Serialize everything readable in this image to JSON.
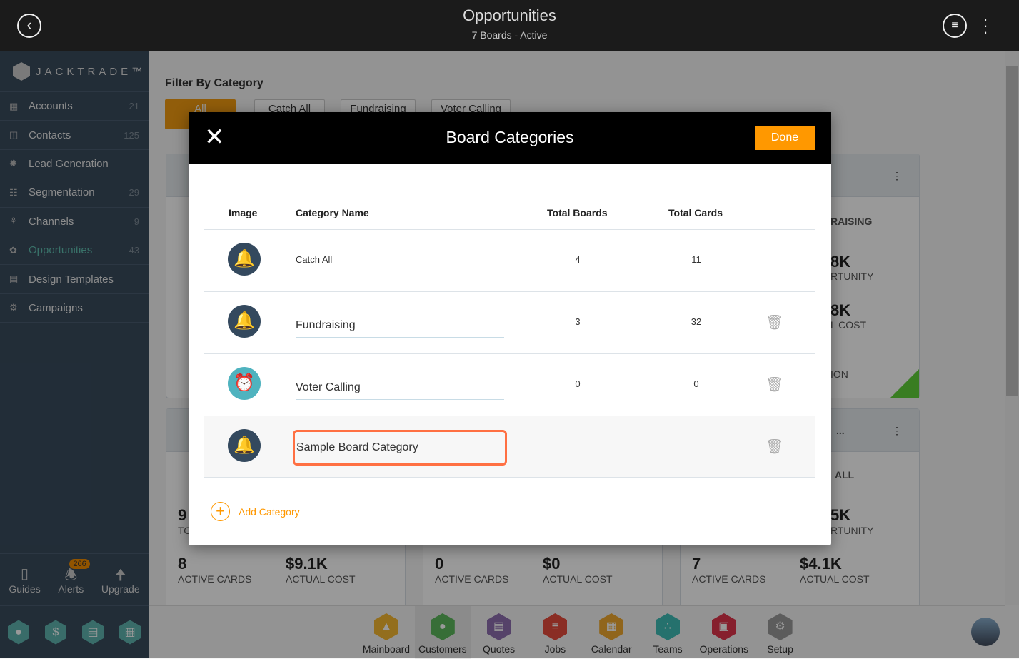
{
  "header": {
    "title": "Opportunities",
    "subtitle": "7 Boards - Active"
  },
  "sidebar": {
    "brand": "JACKTRADE™",
    "items": [
      {
        "label": "Accounts",
        "count": "21",
        "icon": "building-icon"
      },
      {
        "label": "Contacts",
        "count": "125",
        "icon": "contacts-icon"
      },
      {
        "label": "Lead Generation",
        "count": "",
        "icon": "lead-icon"
      },
      {
        "label": "Segmentation",
        "count": "29",
        "icon": "segmentation-icon"
      },
      {
        "label": "Channels",
        "count": "9",
        "icon": "channels-icon"
      },
      {
        "label": "Opportunities",
        "count": "43",
        "icon": "opportunities-icon",
        "active": true
      },
      {
        "label": "Design Templates",
        "count": "",
        "icon": "templates-icon"
      },
      {
        "label": "Campaigns",
        "count": "",
        "icon": "campaigns-icon"
      }
    ],
    "bottom": {
      "guides": "Guides",
      "alerts": "Alerts",
      "alerts_badge": "266",
      "upgrade": "Upgrade"
    }
  },
  "main": {
    "filter_title": "Filter By Category",
    "filters": [
      "All",
      "Catch All",
      "Fundraising",
      "Voter Calling"
    ],
    "cards": {
      "r1c3": {
        "title": "RAISING",
        "v1": "8K",
        "l1": "RTUNITY",
        "v2": "8K",
        "l2": "L COST",
        "l3": "ION"
      },
      "r2c1": {
        "v0": "9",
        "l0": "TO",
        "v1": "8",
        "l1": "ACTIVE CARDS",
        "v2": "$9.1K",
        "l2": "ACTUAL COST"
      },
      "r2c2": {
        "v1": "0",
        "l1": "ACTIVE CARDS",
        "v2": "$0",
        "l2": "ACTUAL COST"
      },
      "r2c3": {
        "head": "...",
        "title": "ALL",
        "v0": "5K",
        "l0": "RTUNITY",
        "v1": "7",
        "l1": "ACTIVE CARDS",
        "v2": "$4.1K",
        "l2": "ACTUAL COST"
      }
    }
  },
  "bottom_nav": [
    {
      "label": "Mainboard",
      "color": "#f5b731"
    },
    {
      "label": "Customers",
      "color": "#5cb85c"
    },
    {
      "label": "Quotes",
      "color": "#8e6fb0"
    },
    {
      "label": "Jobs",
      "color": "#e74c3c"
    },
    {
      "label": "Calendar",
      "color": "#f0a830"
    },
    {
      "label": "Teams",
      "color": "#3ebdb6"
    },
    {
      "label": "Operations",
      "color": "#e0344c"
    },
    {
      "label": "Setup",
      "color": "#999999"
    }
  ],
  "modal": {
    "title": "Board Categories",
    "done": "Done",
    "columns": {
      "image": "Image",
      "name": "Category Name",
      "boards": "Total Boards",
      "cards": "Total Cards"
    },
    "rows": [
      {
        "name": "Catch All",
        "boards": "4",
        "cards": "11",
        "icon": "bell-icon"
      },
      {
        "name": "Fundraising",
        "boards": "3",
        "cards": "32",
        "icon": "bell-icon"
      },
      {
        "name": "Voter Calling",
        "boards": "0",
        "cards": "0",
        "icon": "alarm-clock-icon"
      },
      {
        "name": "Sample Board Category",
        "boards": "",
        "cards": "",
        "icon": "bell-icon"
      }
    ],
    "add": "Add Category"
  },
  "colors": {
    "accent": "#ff9800",
    "focus_border": "#ff7043",
    "sidebar_active": "#5fbfb0"
  }
}
